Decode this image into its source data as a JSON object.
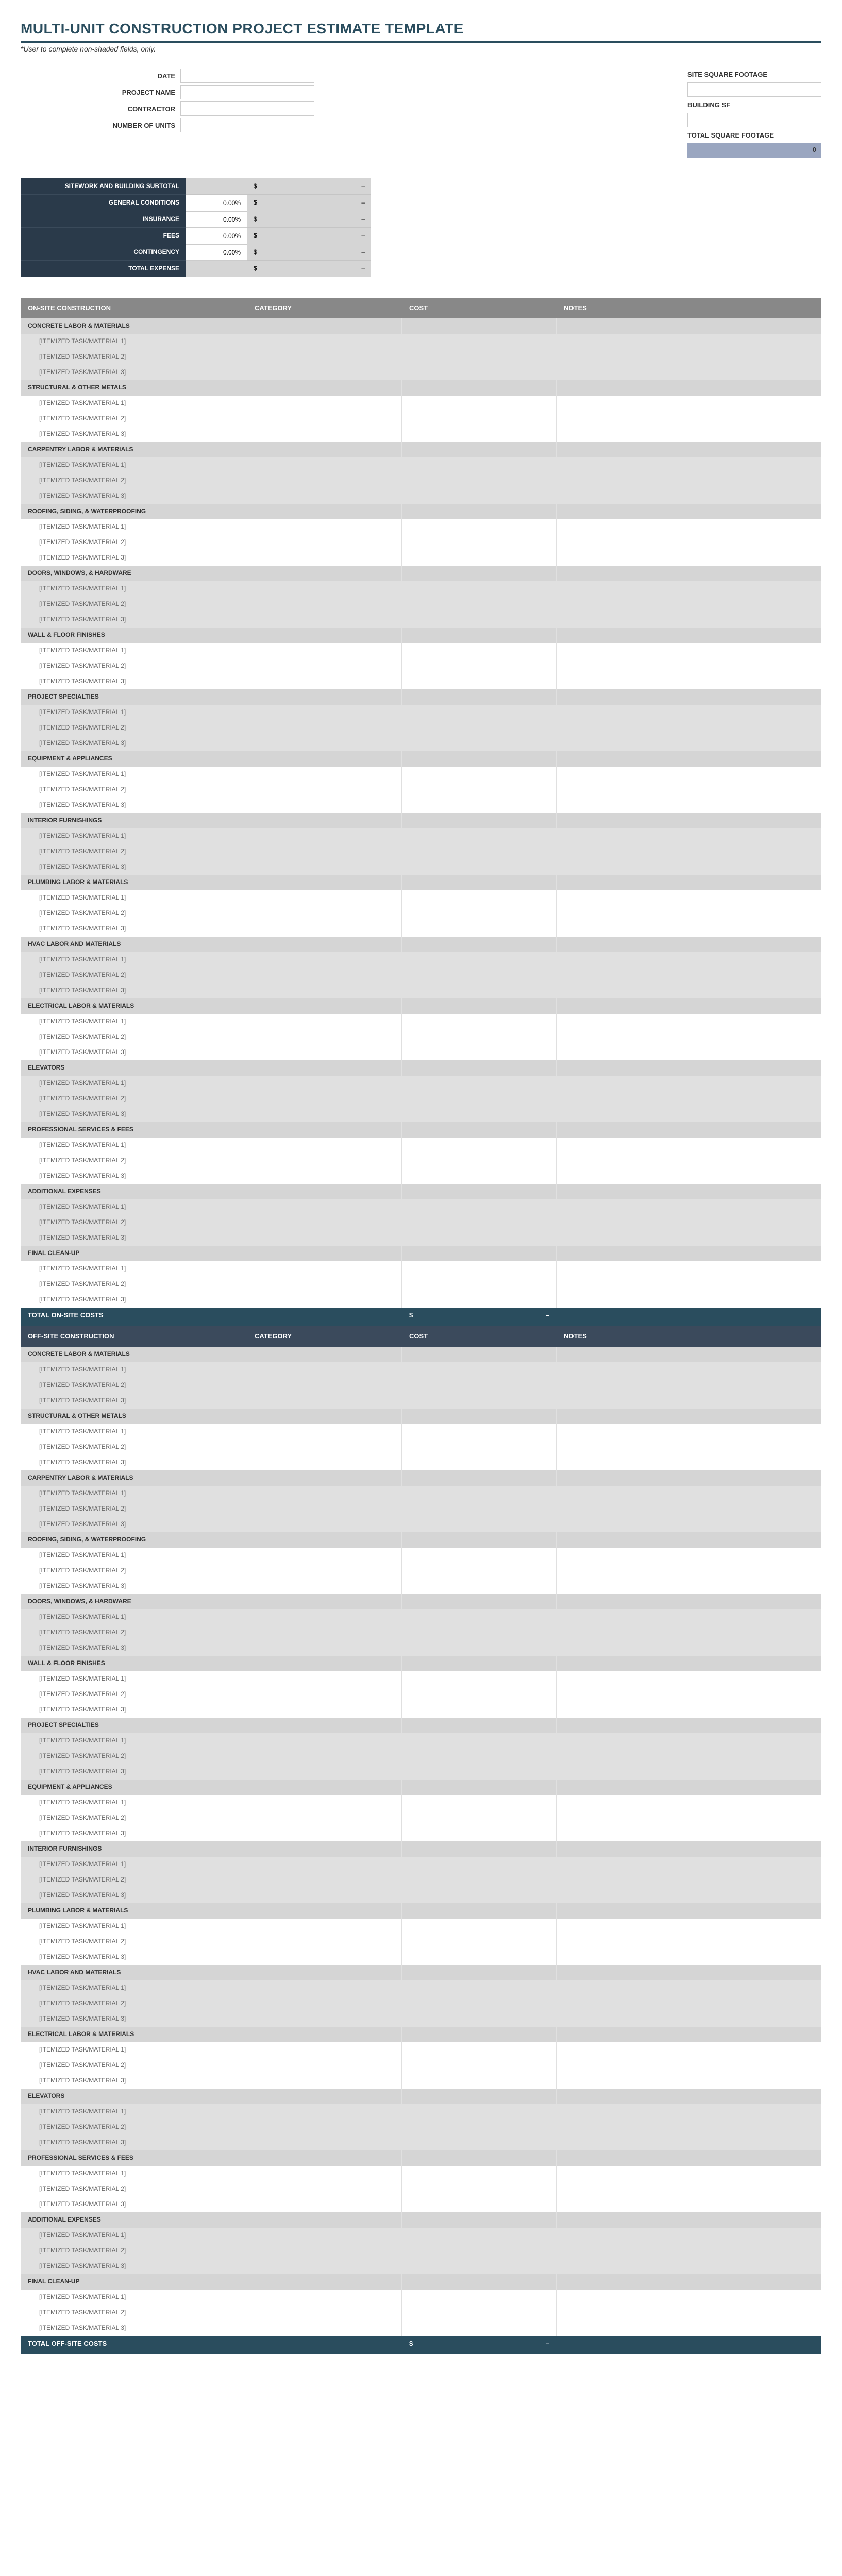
{
  "title": "MULTI-UNIT CONSTRUCTION PROJECT ESTIMATE TEMPLATE",
  "note": "*User to complete non-shaded fields, only.",
  "info": [
    {
      "label": "DATE"
    },
    {
      "label": "PROJECT NAME"
    },
    {
      "label": "CONTRACTOR"
    },
    {
      "label": "NUMBER OF UNITS"
    }
  ],
  "sf": {
    "site": "SITE SQUARE FOOTAGE",
    "building": "BUILDING SF",
    "total": "TOTAL SQUARE FOOTAGE",
    "total_val": "0"
  },
  "summary": [
    {
      "label": "SITEWORK AND BUILDING SUBTOTAL",
      "pct": "",
      "amt_pre": "$",
      "amt": "–",
      "nopct": true
    },
    {
      "label": "GENERAL CONDITIONS",
      "pct": "0.00%",
      "amt_pre": "$",
      "amt": "–"
    },
    {
      "label": "INSURANCE",
      "pct": "0.00%",
      "amt_pre": "$",
      "amt": "–"
    },
    {
      "label": "FEES",
      "pct": "0.00%",
      "amt_pre": "$",
      "amt": "–"
    },
    {
      "label": "CONTINGENCY",
      "pct": "0.00%",
      "amt_pre": "$",
      "amt": "–"
    },
    {
      "label": "TOTAL EXPENSE",
      "pct": "",
      "amt_pre": "$",
      "amt": "–",
      "nopct": true
    }
  ],
  "headers": {
    "col1_on": "ON-SITE CONSTRUCTION",
    "col1_off": "OFF-SITE CONSTRUCTION",
    "col2": "CATEGORY",
    "col3": "COST",
    "col4": "NOTES"
  },
  "categories": [
    "CONCRETE LABOR & MATERIALS",
    "STRUCTURAL & OTHER METALS",
    "CARPENTRY LABOR & MATERIALS",
    "ROOFING, SIDING, & WATERPROOFING",
    "DOORS, WINDOWS, & HARDWARE",
    "WALL & FLOOR FINISHES",
    "PROJECT SPECIALTIES",
    "EQUIPMENT & APPLIANCES",
    "INTERIOR FURNISHINGS",
    "PLUMBING LABOR & MATERIALS",
    "HVAC LABOR AND MATERIALS",
    "ELECTRICAL LABOR & MATERIALS",
    "ELEVATORS",
    "PROFESSIONAL SERVICES & FEES",
    "ADDITIONAL EXPENSES",
    "FINAL CLEAN-UP"
  ],
  "item_labels": [
    "[ITEMIZED TASK/MATERIAL 1]",
    "[ITEMIZED TASK/MATERIAL 2]",
    "[ITEMIZED TASK/MATERIAL 3]"
  ],
  "total_on": "TOTAL ON-SITE COSTS",
  "total_off": "TOTAL OFF-SITE COSTS",
  "total_amt_pre": "$",
  "total_amt": "–"
}
